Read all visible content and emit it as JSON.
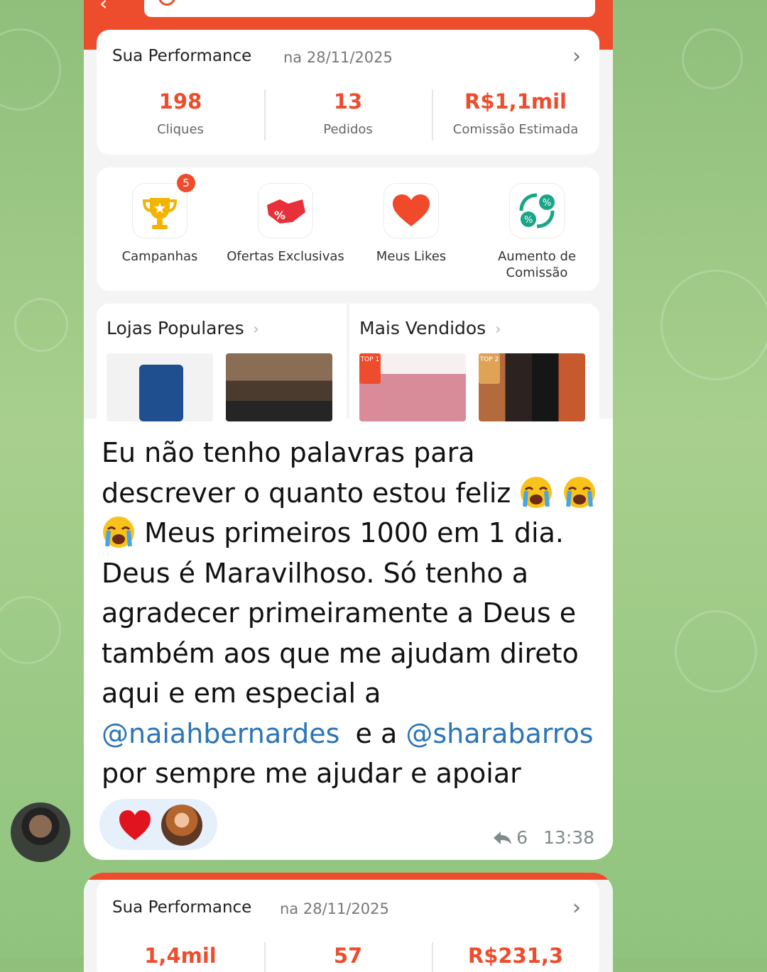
{
  "performance_card": {
    "title": "Sua Performance",
    "date": "na 28/11/2025",
    "metrics": [
      {
        "value": "198",
        "label": "Cliques"
      },
      {
        "value": "13",
        "label": "Pedidos"
      },
      {
        "value": "R$1,1mil",
        "label": "Comissão Estimada"
      }
    ]
  },
  "shortcuts": [
    {
      "label": "Campanhas",
      "icon": "trophy-icon",
      "badge": "5"
    },
    {
      "label": "Ofertas Exclusivas",
      "icon": "handshake-icon"
    },
    {
      "label": "Meus Likes",
      "icon": "heart-icon"
    },
    {
      "label": "Aumento de Comissão",
      "icon": "commission-icon"
    }
  ],
  "lists": {
    "popular_stores": "Lojas Populares",
    "best_sellers": "Mais Vendidos",
    "top_tags": [
      "TOP 1",
      "TOP 2"
    ]
  },
  "message": {
    "line1": "Eu não tenho palavras para",
    "line2": "descrever o quanto estou feliz",
    "line3": "Meus primeiros 1000 em 1 dia.",
    "line4": "Deus é Maravilhoso. Só tenho a",
    "line5": "agradecer primeiramente a Deus e",
    "line6": "também aos que me ajudam direto",
    "line7": "aqui e em especial a",
    "mention1": "@naiahbernardes",
    "connector": "e a",
    "mention2": "@sharabarros",
    "line9": "por sempre me ajudar e apoiar",
    "reply_count": "6",
    "time": "13:38"
  },
  "performance_card_2": {
    "title": "Sua Performance",
    "date": "na 28/11/2025",
    "metrics": [
      {
        "value": "1,4mil"
      },
      {
        "value": "57"
      },
      {
        "value": "R$231,3"
      }
    ]
  },
  "colors": {
    "accent": "#ee4d2d",
    "mention": "#2a74b8",
    "chat_background": "#9fca86"
  }
}
